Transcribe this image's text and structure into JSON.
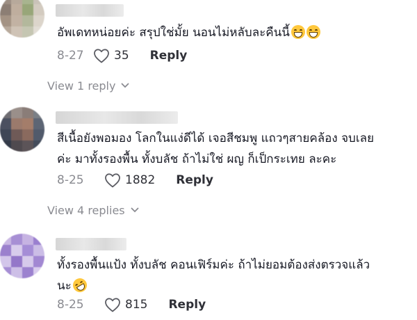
{
  "comments": [
    {
      "text_lines": [
        "อัพเดทหน่อยค่ะ สรุปใช่มั้ย นอนไม่หลับละคืนนี้"
      ],
      "emojis": [
        "grinning-squinting-face",
        "grinning-squinting-face"
      ],
      "date": "8-27",
      "likes": "35",
      "reply_label": "Reply",
      "view_replies": "View 1 reply"
    },
    {
      "text_lines": [
        "สีเนื้อยังพอมอง โลกในแง่ดีได้ เจอสีชมพู แถวๆสายคล้อง จบเลย",
        "ค่ะ มาทั้งรองพื้น ทั้งบลัช ถ้าไม่ใช่ ผญ ก็เป็กระเทย ละคะ"
      ],
      "date": "8-25",
      "likes": "1882",
      "reply_label": "Reply",
      "view_replies": "View 4 replies"
    },
    {
      "text_lines": [
        "ทั้งรองพื้นแป้ง ทั้งบลัช คอนเฟิร์มค่ะ ถ้าไม่ยอมต้องส่งตรวจแล้ว",
        "นะ"
      ],
      "emojis": [
        "rolling-on-floor-laughing-face"
      ],
      "date": "8-25",
      "likes": "815",
      "reply_label": "Reply"
    }
  ],
  "icons": {
    "like": "heart-outline-icon",
    "expand": "chevron-down-icon"
  },
  "colors": {
    "text": "#161823",
    "muted": "#8a8b91",
    "emoji": "#ffc83d"
  }
}
